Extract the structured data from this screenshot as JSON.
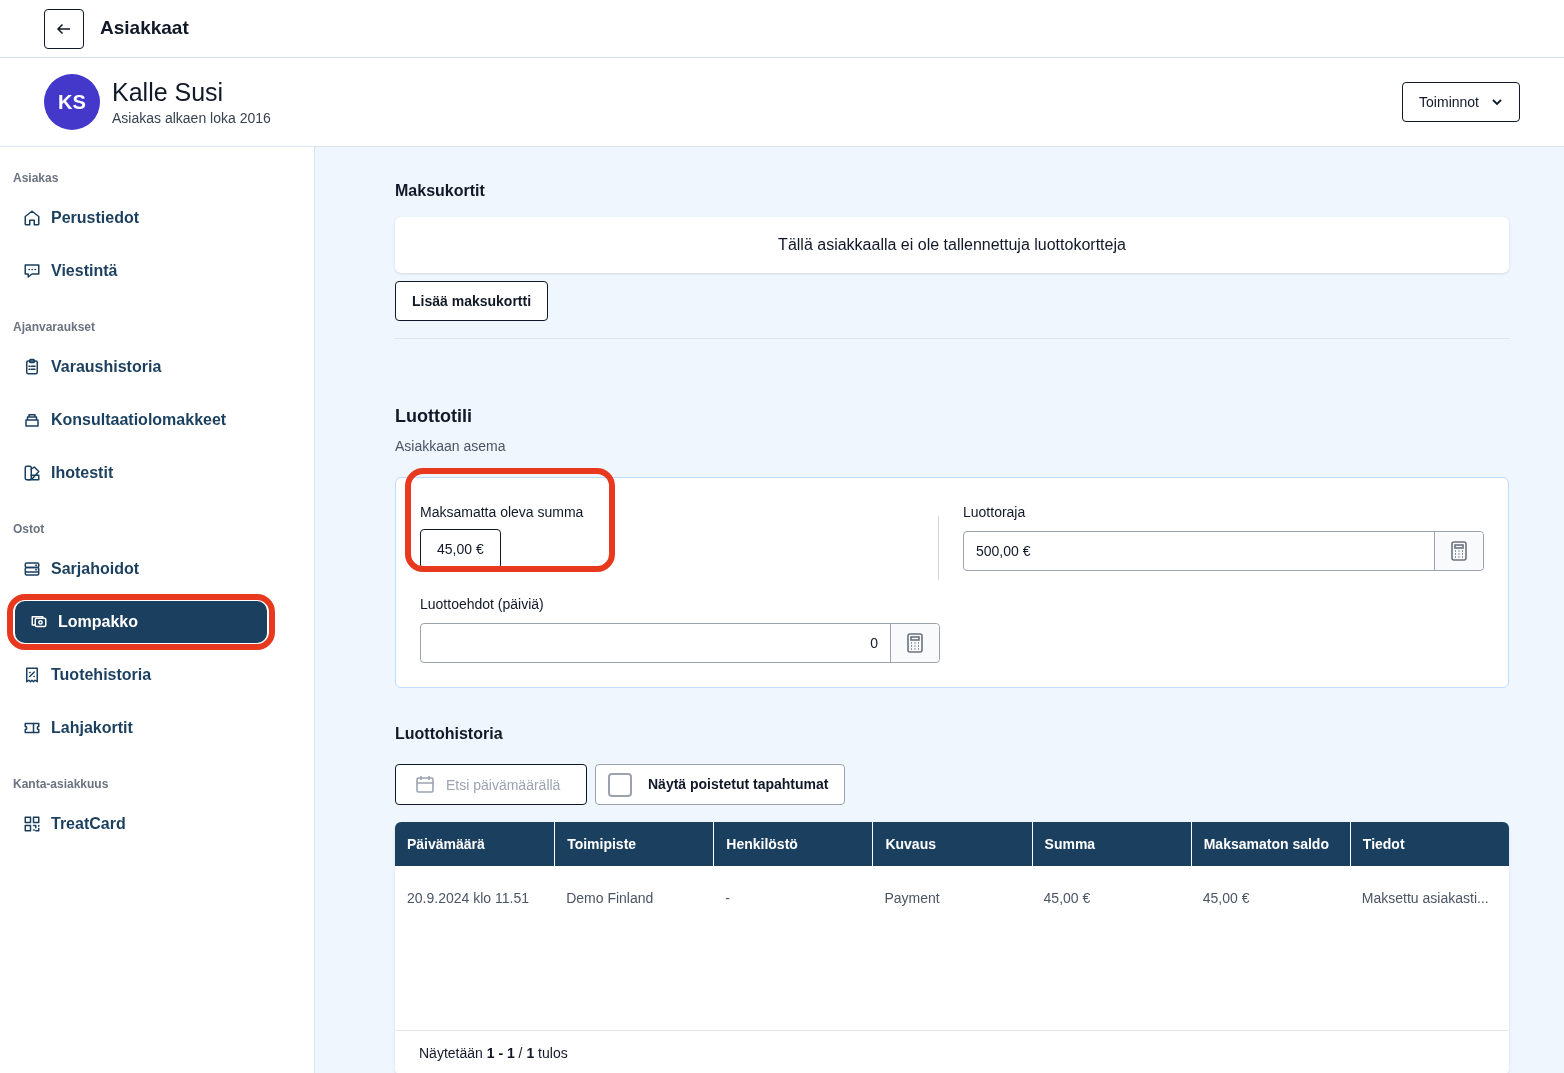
{
  "topbar": {
    "title": "Asiakkaat"
  },
  "customer": {
    "initials": "KS",
    "name": "Kalle Susi",
    "since": "Asiakas alkaen loka 2016",
    "actions_button": "Toiminnot"
  },
  "sidebar": {
    "sections": [
      {
        "heading": "Asiakas",
        "items": [
          {
            "label": "Perustiedot",
            "kind": "home",
            "selected": false,
            "highlighted": false
          },
          {
            "label": "Viestintä",
            "kind": "chat",
            "selected": false,
            "highlighted": false
          }
        ]
      },
      {
        "heading": "Ajanvaraukset",
        "items": [
          {
            "label": "Varaushistoria",
            "kind": "clipboard",
            "selected": false,
            "highlighted": false
          },
          {
            "label": "Konsultaatiolomakkeet",
            "kind": "tray",
            "selected": false,
            "highlighted": false
          },
          {
            "label": "Ihotestit",
            "kind": "swatch",
            "selected": false,
            "highlighted": false
          }
        ]
      },
      {
        "heading": "Ostot",
        "items": [
          {
            "label": "Sarjahoidot",
            "kind": "stack",
            "selected": false,
            "highlighted": false
          },
          {
            "label": "Lompakko",
            "kind": "cash",
            "selected": true,
            "highlighted": true
          },
          {
            "label": "Tuotehistoria",
            "kind": "receipt",
            "selected": false,
            "highlighted": false
          },
          {
            "label": "Lahjakortit",
            "kind": "ticket",
            "selected": false,
            "highlighted": false
          }
        ]
      },
      {
        "heading": "Kanta-asiakkuus",
        "items": [
          {
            "label": "TreatCard",
            "kind": "qr",
            "selected": false,
            "highlighted": false
          }
        ]
      }
    ]
  },
  "payment_cards": {
    "title": "Maksukortit",
    "empty_message": "Tällä asiakkaalla ei ole tallennettuja luottokortteja",
    "add_button": "Lisää maksukortti"
  },
  "credit_account": {
    "title": "Luottotili",
    "subtitle": "Asiakkaan asema",
    "outstanding": {
      "label": "Maksamatta oleva summa",
      "value": "45,00 €",
      "highlighted": true
    },
    "credit_limit": {
      "label": "Luottoraja",
      "value": "500,00 €"
    },
    "credit_terms": {
      "label": "Luottoehdot (päiviä)",
      "value": "0"
    }
  },
  "credit_history": {
    "title": "Luottohistoria",
    "date_filter": {
      "placeholder": "Etsi päivämäärällä"
    },
    "show_deleted": {
      "label": "Näytä poistetut tapahtumat",
      "checked": false
    },
    "table": {
      "columns": [
        "Päivämäärä",
        "Toimipiste",
        "Henkilöstö",
        "Kuvaus",
        "Summa",
        "Maksamaton saldo",
        "Tiedot"
      ],
      "rows": [
        [
          "20.9.2024 klo 11.51",
          "Demo Finland",
          "-",
          "Payment",
          "45,00 €",
          "45,00 €",
          "Maksettu asiakasti..."
        ]
      ]
    },
    "footer": "Näytetään **1 - 1** / **1** tulos"
  }
}
